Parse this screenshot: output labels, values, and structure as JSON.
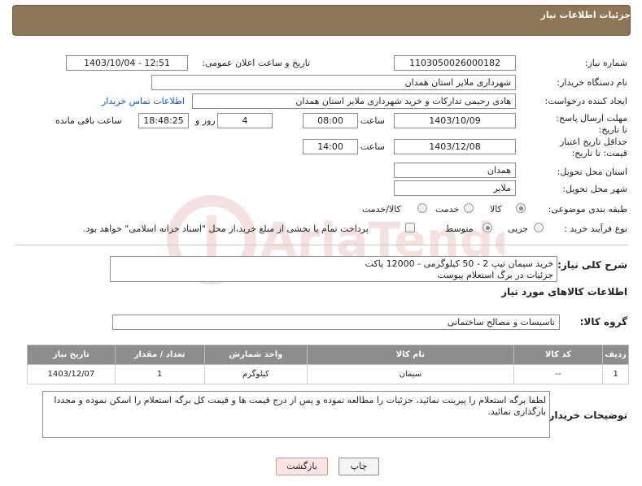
{
  "header": {
    "title": "جزئیات اطلاعات نیاز"
  },
  "fields": {
    "need_number": {
      "label": "شماره نیاز:",
      "value": "1103050026000182"
    },
    "announce_datetime": {
      "label": "تاریخ و ساعت اعلان عمومی:",
      "value": "1403/10/04 - 12:51"
    },
    "buyer_org": {
      "label": "نام دستگاه خریدار:",
      "value": "شهرداری ملایر استان همدان"
    },
    "requester": {
      "label": "ایجاد کننده درخواست:",
      "value": "هادی رحیمی تدارکات و خرید شهرداری ملایر استان همدان",
      "link": "اطلاعات تماس خریدار"
    },
    "reply_deadline": {
      "label": "مهلت ارسال پاسخ: تا تاریخ:",
      "date": "1403/10/09",
      "time_label": "ساعت",
      "time": "08:00",
      "days": "4",
      "days_label": "روز و",
      "remaining": "18:48:25",
      "remaining_label": "ساعت باقی مانده"
    },
    "price_validity": {
      "label": "حداقل تاریخ اعتبار قیمت: تا تاریخ:",
      "date": "1403/12/08",
      "time_label": "ساعت",
      "time": "14:00"
    },
    "delivery_province": {
      "label": "استان محل تحویل:",
      "value": "همدان"
    },
    "delivery_city": {
      "label": "شهر محل تحویل:",
      "value": "ملایر"
    },
    "category": {
      "label": "طبقه بندی موضوعی:",
      "options": [
        "کالا",
        "خدمت",
        "کالا/خدمت"
      ]
    },
    "process_type": {
      "label": "نوع فرآیند خرید :",
      "options": [
        "جزیی",
        "متوسط"
      ],
      "note": "پرداخت تمام یا بخشی از مبلغ خرید،از محل \"اسناد خزانه اسلامی\" خواهد بود."
    }
  },
  "description": {
    "label": "شرح کلی نیاز:",
    "line1": "خرید سیمان تیپ 2 - 50 کیلوگرمی - 12000 پاکت",
    "line2": "جزئیات در برگ استعلام پیوست"
  },
  "goods_section": {
    "title": "اطلاعات کالاهای مورد نیاز",
    "group_label": "گروه کالا:",
    "group_value": "تاسیسات و مصالح ساختمانی"
  },
  "table": {
    "headers": [
      "ردیف",
      "کد کالا",
      "نام کالا",
      "واحد شمارش",
      "تعداد / مقدار",
      "تاریخ نیاز"
    ],
    "rows": [
      [
        "1",
        "--",
        "سیمان",
        "کیلوگرم",
        "1",
        "1403/12/07"
      ]
    ]
  },
  "buyer_notes": {
    "label": "توضیحات خریدار:",
    "text": "لطفا برگه استعلام را پیرینت نمائید، جزئیات را مطالعه نموده و پس از درج قیمت ها و قیمت کل برگه استعلام را اسکن نموده و مجددا بارگذاری نمائید."
  },
  "buttons": {
    "print": "چاپ",
    "back": "بازگشت"
  },
  "watermark": "AriaTender.net"
}
